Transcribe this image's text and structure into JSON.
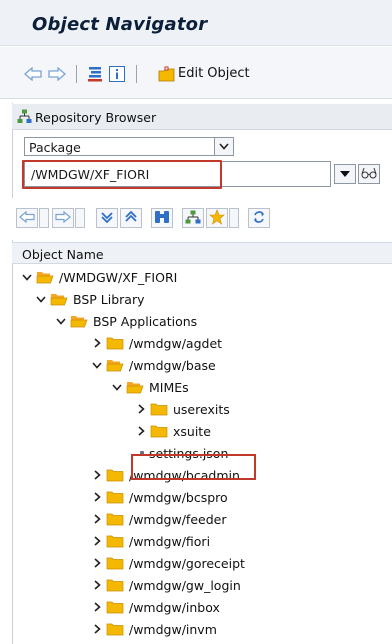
{
  "window": {
    "title": "Object Navigator"
  },
  "toolbar": {
    "edit_object_label": "Edit Object"
  },
  "repository": {
    "header_label": "Repository Browser",
    "object_type": "Package",
    "package_path": "/WMDGW/XF_FIORI"
  },
  "tree": {
    "column_header": "Object Name",
    "nodes": [
      {
        "label": "/WMDGW/XF_FIORI",
        "level": 0,
        "expanded": true,
        "kind": "folder"
      },
      {
        "label": "BSP Library",
        "level": 1,
        "expanded": true,
        "kind": "folder"
      },
      {
        "label": "BSP Applications",
        "level": 2,
        "expanded": true,
        "kind": "folder"
      },
      {
        "label": "/wmdgw/agdet",
        "level": 3,
        "expanded": false,
        "kind": "folder"
      },
      {
        "label": "/wmdgw/base",
        "level": 3,
        "expanded": true,
        "kind": "folder"
      },
      {
        "label": "MIMEs",
        "level": 4,
        "expanded": true,
        "kind": "folder"
      },
      {
        "label": "userexits",
        "level": 5,
        "expanded": false,
        "kind": "folder"
      },
      {
        "label": "xsuite",
        "level": 5,
        "expanded": false,
        "kind": "folder"
      },
      {
        "label": "settings.json",
        "level": 5,
        "expanded": false,
        "kind": "file"
      },
      {
        "label": "/wmdgw/bcadmin",
        "level": 3,
        "expanded": false,
        "kind": "folder"
      },
      {
        "label": "/wmdgw/bcspro",
        "level": 3,
        "expanded": false,
        "kind": "folder"
      },
      {
        "label": "/wmdgw/feeder",
        "level": 3,
        "expanded": false,
        "kind": "folder"
      },
      {
        "label": "/wmdgw/fiori",
        "level": 3,
        "expanded": false,
        "kind": "folder"
      },
      {
        "label": "/wmdgw/goreceipt",
        "level": 3,
        "expanded": false,
        "kind": "folder"
      },
      {
        "label": "/wmdgw/gw_login",
        "level": 3,
        "expanded": false,
        "kind": "folder"
      },
      {
        "label": "/wmdgw/inbox",
        "level": 3,
        "expanded": false,
        "kind": "folder"
      },
      {
        "label": "/wmdgw/invm",
        "level": 3,
        "expanded": false,
        "kind": "folder"
      }
    ]
  },
  "colors": {
    "highlight_border": "#c0392b",
    "folder_yellow": "#f5b800",
    "folder_open": "#f5a623",
    "icon_blue": "#2f6fc8",
    "nav_arrow": "#7aa3d6"
  }
}
